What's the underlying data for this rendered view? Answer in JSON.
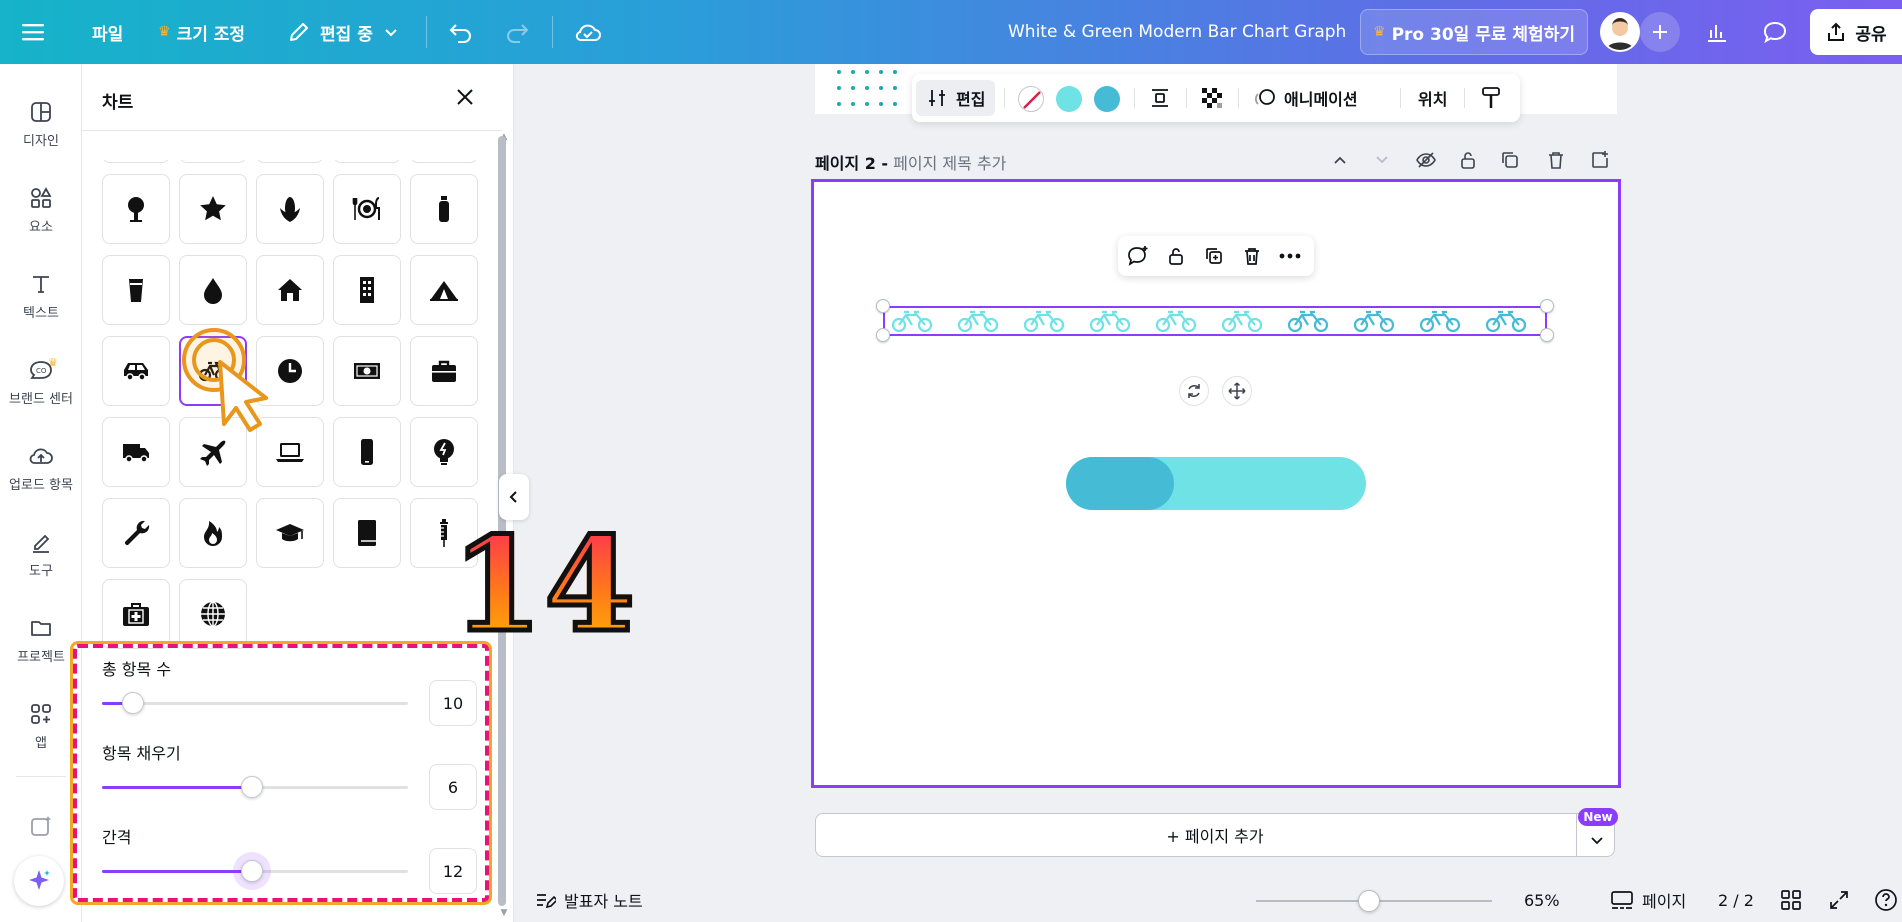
{
  "topbar": {
    "file_label": "파일",
    "resize_label": "크기 조정",
    "edit_mode_label": "편집 중",
    "doc_title": "White & Green Modern Bar Chart Graph",
    "pro_trial_label": "Pro 30일 무료 체험하기",
    "share_label": "공유"
  },
  "rail": {
    "items": [
      {
        "label": "디자인",
        "icon": "design-icon"
      },
      {
        "label": "요소",
        "icon": "elements-icon"
      },
      {
        "label": "텍스트",
        "icon": "text-icon"
      },
      {
        "label": "브랜드 센터",
        "icon": "brand-icon"
      },
      {
        "label": "업로드 항목",
        "icon": "upload-icon"
      },
      {
        "label": "도구",
        "icon": "draw-icon"
      },
      {
        "label": "프로젝트",
        "icon": "folder-icon"
      },
      {
        "label": "앱",
        "icon": "apps-icon"
      }
    ]
  },
  "panel": {
    "title": "차트",
    "icons": [
      "tree-icon",
      "star-icon",
      "corn-icon",
      "dining-icon",
      "bottle-icon",
      "cup-icon",
      "drop-icon",
      "house-icon",
      "building-icon",
      "tent-icon",
      "car-icon",
      "bicycle-icon",
      "clock-icon",
      "money-icon",
      "briefcase-icon",
      "truck-icon",
      "airplane-icon",
      "laptop-icon",
      "phone-icon",
      "bulb-icon",
      "wrench-icon",
      "fire-icon",
      "graduation-cap-icon",
      "book-icon",
      "syringe-icon",
      "first-aid-icon",
      "globe-icon"
    ],
    "selected_icon": "bicycle-icon",
    "sliders": [
      {
        "label": "총 항목 수",
        "value": "10",
        "fraction": 0.1
      },
      {
        "label": "항목 채우기",
        "value": "6",
        "fraction": 0.49
      },
      {
        "label": "간격",
        "value": "12",
        "fraction": 0.49
      }
    ],
    "step_number": "14"
  },
  "editor_toolbar": {
    "edit_label": "편집",
    "animation_label": "애니메이션",
    "position_label": "위치",
    "swatches": [
      "#6ee2e4",
      "#45bbd6"
    ]
  },
  "page": {
    "title": "페이지 2 -",
    "title_placeholder": "페이지 제목 추가",
    "pictograph": {
      "total": 10,
      "filled": 6,
      "filled_color": "#45bbd6",
      "empty_color": "#6ee2e4"
    },
    "progress_bar": {
      "fill_fraction": 0.36,
      "fill_color": "#45bbd6",
      "track_color": "#6ee2e4"
    }
  },
  "add_page": {
    "label": "+ 페이지 추가",
    "badge": "New"
  },
  "bottombar": {
    "notes_label": "발표자 노트",
    "zoom_label": "65%",
    "zoom_fraction": 0.48,
    "pages_label": "페이지",
    "page_count": "2 / 2"
  }
}
